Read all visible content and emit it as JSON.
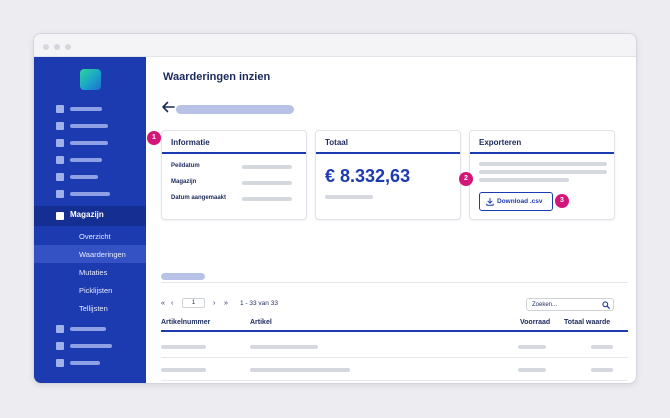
{
  "page": {
    "title": "Waarderingen inzien"
  },
  "sidebar": {
    "active_item": "Magazijn",
    "sub_items": [
      "Overzicht",
      "Waarderingen",
      "Mutaties",
      "Picklijsten",
      "Tellijsten"
    ],
    "selected_sub_item": "Waarderingen"
  },
  "cards": {
    "info": {
      "title": "Informatie",
      "labels": [
        "Peildatum",
        "Magazijn",
        "Datum aangemaakt"
      ]
    },
    "total": {
      "title": "Totaal",
      "value": "€ 8.332,63"
    },
    "export": {
      "title": "Exporteren",
      "button_label": "Download .csv"
    }
  },
  "badges": [
    "1",
    "2",
    "3"
  ],
  "pagination": {
    "first": "«",
    "prev": "‹",
    "page": "1",
    "next": "›",
    "last": "»",
    "info": "1 - 33 van 33"
  },
  "search": {
    "placeholder": "Zoeken..."
  },
  "table": {
    "columns": [
      "Artikelnummer",
      "Artikel",
      "Voorraad",
      "Totaal waarde"
    ]
  },
  "colors": {
    "primary": "#1d3bb0",
    "sidebar_active": "#142e92",
    "badge": "#d4157a",
    "background": "#ececf1"
  },
  "icons": {
    "back": "arrow-left-icon",
    "download": "download-icon",
    "search": "search-icon"
  }
}
